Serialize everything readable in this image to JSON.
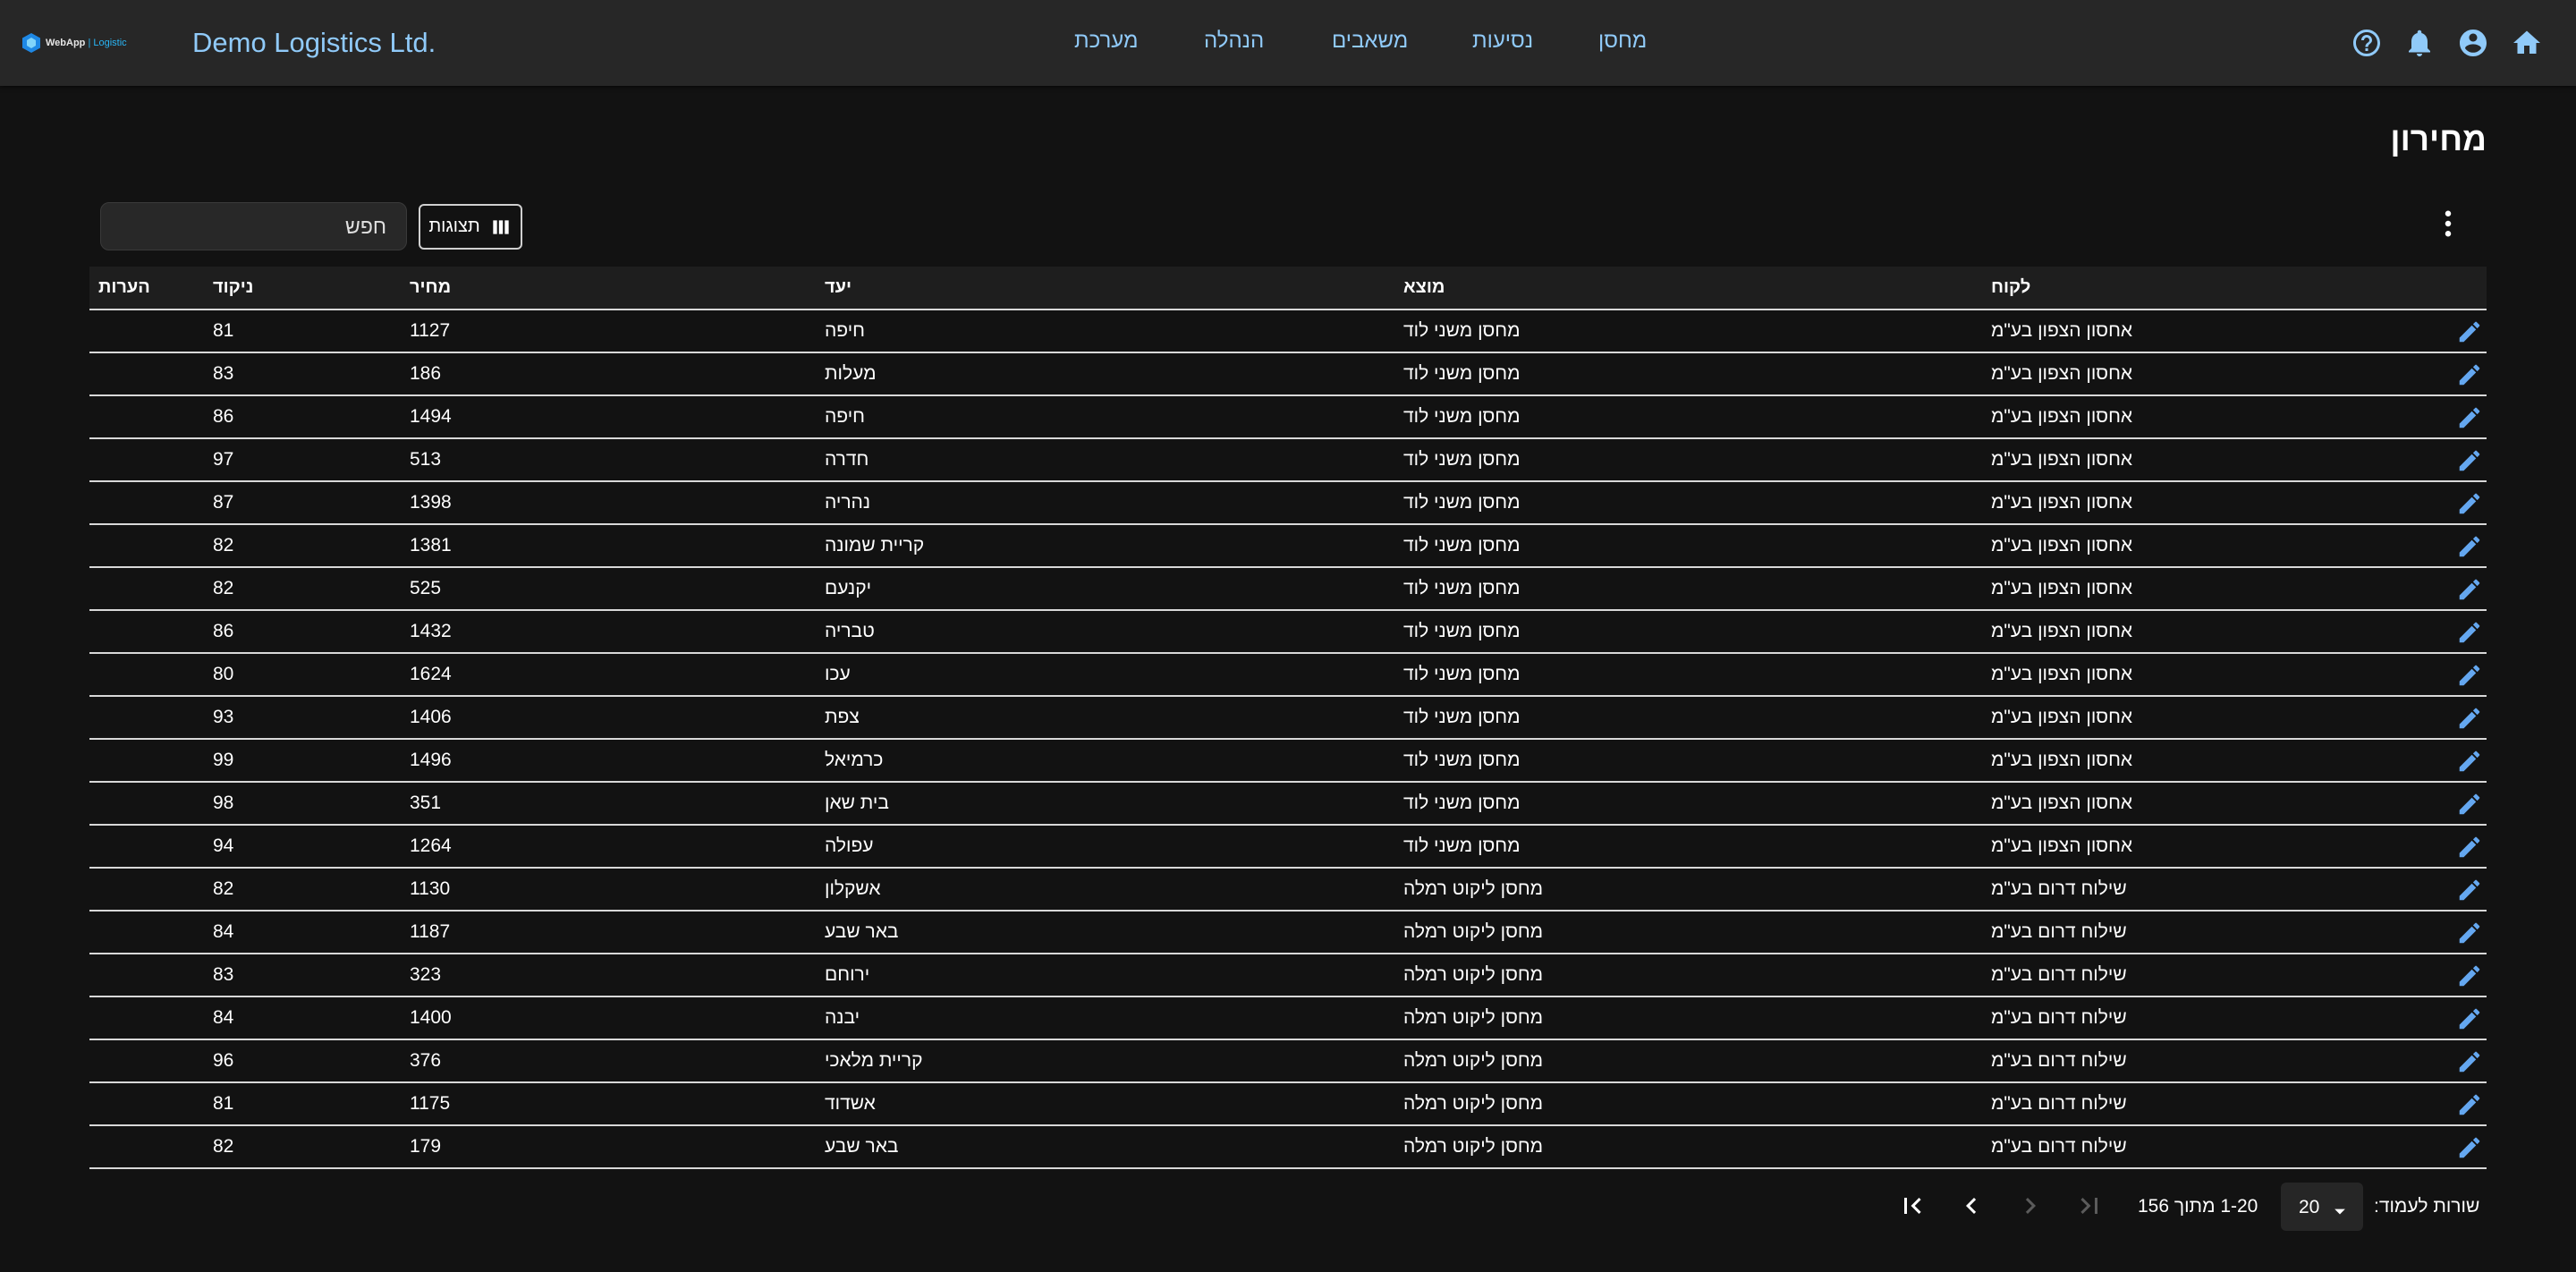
{
  "header": {
    "logo_text": "WebApp",
    "logo_sub": "| Logistic",
    "company": "Demo Logistics Ltd.",
    "nav": [
      "מחסן",
      "נסיעות",
      "משאבים",
      "הנהלה",
      "מערכת"
    ],
    "icons": [
      "home-icon",
      "account-icon",
      "bell-icon",
      "help-icon"
    ]
  },
  "page": {
    "title": "מחירון"
  },
  "toolbar": {
    "search_placeholder": "חפש",
    "columns_label": "תצוגות"
  },
  "table": {
    "headers": {
      "customer": "לקוח",
      "origin": "מוצא",
      "dest": "יעד",
      "price": "מחיר",
      "points": "ניקוד",
      "notes": "הערות"
    },
    "rows": [
      {
        "customer": "אחסון הצפון בע\"מ",
        "origin": "מחסן משני לוד",
        "dest": "חיפה",
        "price": "1127",
        "points": "81",
        "notes": ""
      },
      {
        "customer": "אחסון הצפון בע\"מ",
        "origin": "מחסן משני לוד",
        "dest": "מעלות",
        "price": "186",
        "points": "83",
        "notes": ""
      },
      {
        "customer": "אחסון הצפון בע\"מ",
        "origin": "מחסן משני לוד",
        "dest": "חיפה",
        "price": "1494",
        "points": "86",
        "notes": ""
      },
      {
        "customer": "אחסון הצפון בע\"מ",
        "origin": "מחסן משני לוד",
        "dest": "חדרה",
        "price": "513",
        "points": "97",
        "notes": ""
      },
      {
        "customer": "אחסון הצפון בע\"מ",
        "origin": "מחסן משני לוד",
        "dest": "נהריה",
        "price": "1398",
        "points": "87",
        "notes": ""
      },
      {
        "customer": "אחסון הצפון בע\"מ",
        "origin": "מחסן משני לוד",
        "dest": "קריית שמונה",
        "price": "1381",
        "points": "82",
        "notes": ""
      },
      {
        "customer": "אחסון הצפון בע\"מ",
        "origin": "מחסן משני לוד",
        "dest": "יקנעם",
        "price": "525",
        "points": "82",
        "notes": ""
      },
      {
        "customer": "אחסון הצפון בע\"מ",
        "origin": "מחסן משני לוד",
        "dest": "טבריה",
        "price": "1432",
        "points": "86",
        "notes": ""
      },
      {
        "customer": "אחסון הצפון בע\"מ",
        "origin": "מחסן משני לוד",
        "dest": "עכו",
        "price": "1624",
        "points": "80",
        "notes": ""
      },
      {
        "customer": "אחסון הצפון בע\"מ",
        "origin": "מחסן משני לוד",
        "dest": "צפת",
        "price": "1406",
        "points": "93",
        "notes": ""
      },
      {
        "customer": "אחסון הצפון בע\"מ",
        "origin": "מחסן משני לוד",
        "dest": "כרמיאל",
        "price": "1496",
        "points": "99",
        "notes": ""
      },
      {
        "customer": "אחסון הצפון בע\"מ",
        "origin": "מחסן משני לוד",
        "dest": "בית שאן",
        "price": "351",
        "points": "98",
        "notes": ""
      },
      {
        "customer": "אחסון הצפון בע\"מ",
        "origin": "מחסן משני לוד",
        "dest": "עפולה",
        "price": "1264",
        "points": "94",
        "notes": ""
      },
      {
        "customer": "שילוח דרום בע\"מ",
        "origin": "מחסן ליקוט רמלה",
        "dest": "אשקלון",
        "price": "1130",
        "points": "82",
        "notes": ""
      },
      {
        "customer": "שילוח דרום בע\"מ",
        "origin": "מחסן ליקוט רמלה",
        "dest": "באר שבע",
        "price": "1187",
        "points": "84",
        "notes": ""
      },
      {
        "customer": "שילוח דרום בע\"מ",
        "origin": "מחסן ליקוט רמלה",
        "dest": "ירוחם",
        "price": "323",
        "points": "83",
        "notes": ""
      },
      {
        "customer": "שילוח דרום בע\"מ",
        "origin": "מחסן ליקוט רמלה",
        "dest": "יבנה",
        "price": "1400",
        "points": "84",
        "notes": ""
      },
      {
        "customer": "שילוח דרום בע\"מ",
        "origin": "מחסן ליקוט רמלה",
        "dest": "קריית מלאכי",
        "price": "376",
        "points": "96",
        "notes": ""
      },
      {
        "customer": "שילוח דרום בע\"מ",
        "origin": "מחסן ליקוט רמלה",
        "dest": "אשדוד",
        "price": "1175",
        "points": "81",
        "notes": ""
      },
      {
        "customer": "שילוח דרום בע\"מ",
        "origin": "מחסן ליקוט רמלה",
        "dest": "באר שבע",
        "price": "179",
        "points": "82",
        "notes": ""
      }
    ]
  },
  "pagination": {
    "rows_label": "שורות לעמוד:",
    "rows_value": "20",
    "range": "1-20 מתוך 156"
  },
  "colors": {
    "background": "#121212",
    "appbar": "#272727",
    "accent": "#90caf9",
    "edit_icon": "#64a7f0"
  }
}
